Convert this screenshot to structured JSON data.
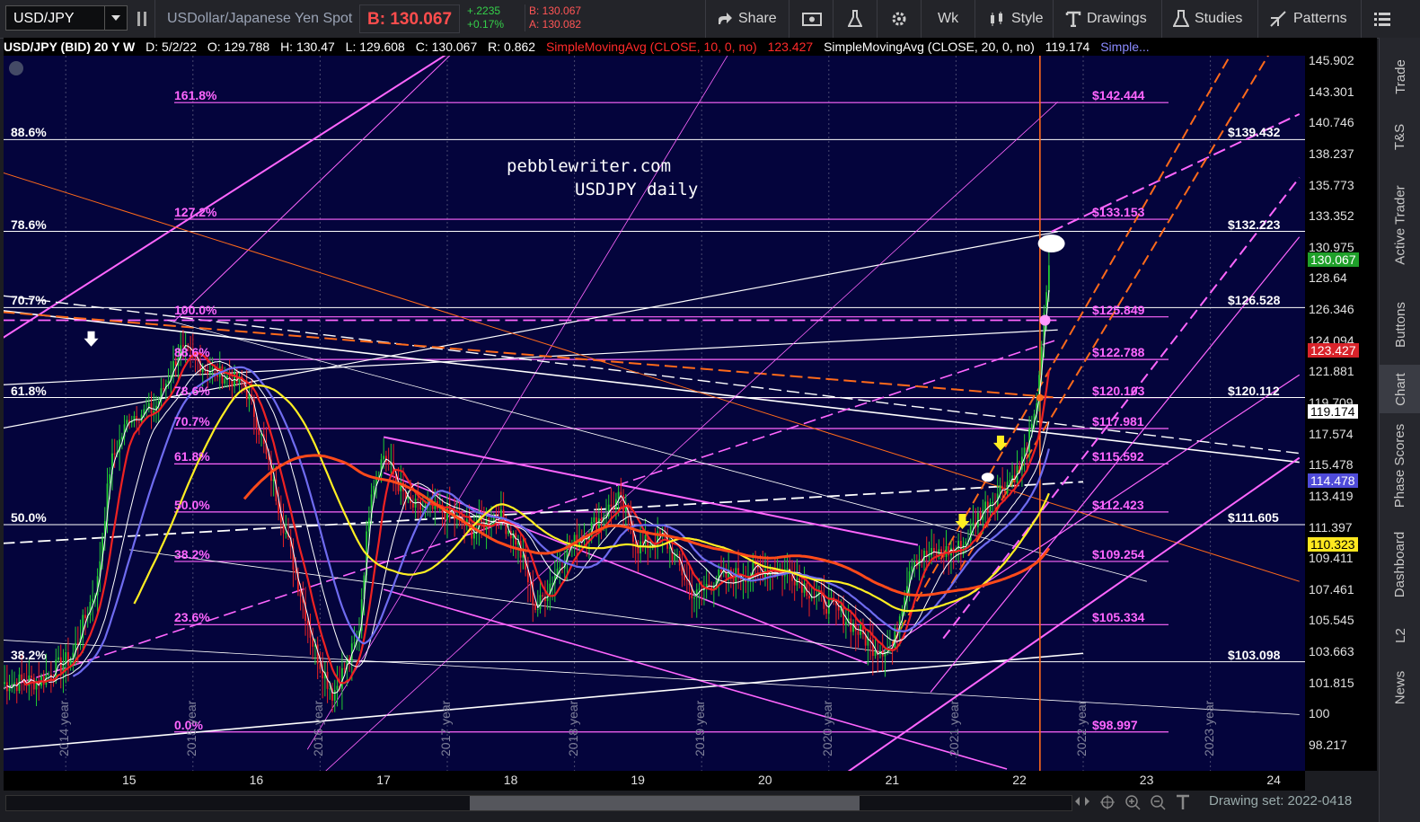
{
  "toolbar": {
    "symbol": "USD/JPY",
    "description": "USDollar/Japanese Yen Spot",
    "bid": "B: 130.067",
    "change": "+.2235",
    "change_pct": "+0.17%",
    "bid_small": "B: 130.067",
    "ask_small": "A: 130.082",
    "share_label": "Share",
    "period_label": "Wk",
    "style_label": "Style",
    "drawings_label": "Drawings",
    "studies_label": "Studies",
    "patterns_label": "Patterns"
  },
  "infobar": {
    "title": "USD/JPY (BID) 20 Y W",
    "date": "D: 5/2/22",
    "open": "O: 129.788",
    "high": "H: 130.47",
    "low": "L: 129.608",
    "close": "C: 130.067",
    "range": "R: 0.862",
    "sma10": "SimpleMovingAvg (CLOSE, 10, 0, no)",
    "sma10_val": "123.427",
    "sma20": "SimpleMovingAvg (CLOSE, 20, 0, no)",
    "sma20_val": "119.174",
    "more": "Simple..."
  },
  "watermark": {
    "line1": "pebblewriter.com",
    "line2": "USDJPY daily"
  },
  "chart_data": {
    "type": "line",
    "y_range": [
      96.8,
      147.2
    ],
    "y_ticks": [
      "145.902",
      "143.301",
      "140.746",
      "138.237",
      "135.773",
      "133.352",
      "130.975",
      "128.64",
      "126.346",
      "124.094",
      "121.881",
      "119.709",
      "117.574",
      "115.478",
      "113.419",
      "111.397",
      "109.411",
      "107.461",
      "105.545",
      "103.663",
      "101.815",
      "100",
      "98.217"
    ],
    "x_ticks": [
      "15",
      "16",
      "17",
      "18",
      "19",
      "20",
      "21",
      "22",
      "23",
      "24"
    ],
    "year_labels": [
      "2014 year",
      "2015 year",
      "2016 year",
      "2017 year",
      "2018 year",
      "2019 year",
      "2020 year",
      "2021 year",
      "2022 year",
      "2023 year"
    ],
    "last_price": "130.067",
    "sma10_badge": "123.427",
    "sma20_badge": "119.174",
    "blue_badge": "114.478",
    "yellow_badge": "110.323",
    "fib_left_magenta": [
      "161.8%",
      "127.2%",
      "100.0%",
      "88.6%",
      "78.6%",
      "70.7%",
      "61.8%",
      "50.0%",
      "38.2%",
      "23.6%",
      "0.0%"
    ],
    "fib_left_white": [
      "88.6%",
      "78.6%",
      "70.7%",
      "61.8%",
      "50.0%",
      "38.2%"
    ],
    "price_magenta": [
      "$142.444",
      "$133.153",
      "$125.849",
      "$122.788",
      "$120.103",
      "$117.981",
      "$115.592",
      "$112.423",
      "$109.254",
      "$105.334",
      "$98.997"
    ],
    "price_white": [
      "$139.432",
      "$132.223",
      "$126.528",
      "$120.112",
      "$111.605",
      "$103.098"
    ],
    "colors": {
      "background": "#04043c",
      "magenta": "#ff66ff",
      "white": "#ffffff",
      "orange": "#ff6a1a",
      "yellow": "#ffee22",
      "blue": "#6f6cf0",
      "up": "#22cc33",
      "down": "#ee2222"
    }
  },
  "sidebar": [
    "Trade",
    "T&S",
    "Active Trader",
    "Buttons",
    "Chart",
    "Phase Scores",
    "Dashboard",
    "L2",
    "News"
  ],
  "bottombar": {
    "drawing_set": "Drawing set: 2022-0418"
  }
}
